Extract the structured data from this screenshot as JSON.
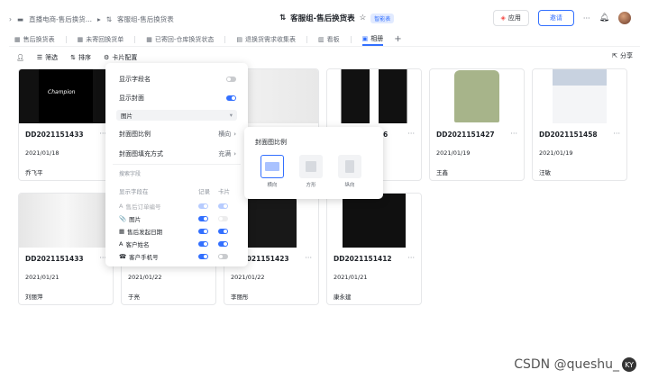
{
  "topbar": {
    "breadcrumb_folder": "直播电商-售后换货...",
    "breadcrumb_sep": "▸",
    "breadcrumb_doc": "客服组-售后换货表",
    "title": "客服组-售后换货表",
    "badge": "智能表",
    "app_label": "应用",
    "share_label": "邀请",
    "more": "···"
  },
  "tabs": [
    {
      "label": "售后换货表"
    },
    {
      "label": "未寄回换货单"
    },
    {
      "label": "已寄回-仓库换货状态"
    },
    {
      "label": "退换货需求收集表"
    },
    {
      "label": "看板"
    },
    {
      "label": "相册",
      "active": true
    }
  ],
  "toolbar": {
    "filter": "筛选",
    "sort": "排序",
    "card_config": "卡片配置",
    "share": "分享"
  },
  "cards": [
    {
      "id": "DD2021151433",
      "date": "2021/01/18",
      "name": "乔飞平",
      "cover": "#111111",
      "more": "···"
    },
    {
      "id": "DD2021151427",
      "date": "2021/01/19",
      "name": "王鑫",
      "cover": "#a7b48a",
      "more": "···"
    },
    {
      "id": "DD2021151458",
      "date": "2021/01/19",
      "name": "汪敏",
      "cover": "#eef0f4",
      "more": "···"
    },
    {
      "id": "DD2021151433",
      "date": "2021/01/21",
      "name": "刘丽萍",
      "cover": "#e8e8e8",
      "more": "···"
    },
    {
      "id": "",
      "date": "2021/01/22",
      "name": "于亮",
      "cover": "#222222",
      "more": "···"
    },
    {
      "id": "DD2021151423",
      "date": "2021/01/22",
      "name": "李丽彤",
      "cover": "#181818",
      "more": "···"
    },
    {
      "id": "DD2021151412",
      "date": "2021/01/21",
      "name": "康永建",
      "cover": "#101010",
      "more": "···"
    }
  ],
  "partial_card": {
    "id_suffix": "6",
    "more": "···"
  },
  "panel": {
    "show_field_name": "显示字段名",
    "show_cover": "显示封面",
    "cover_field": "图片",
    "cover_ratio": "封面图比例",
    "cover_ratio_value": "横向",
    "cover_fill": "封面图填充方式",
    "cover_fill_value": "充满",
    "search_fields": "搜索字段",
    "shown_fields": "显示字段在",
    "col_record": "记录",
    "col_card": "卡片",
    "fields": [
      {
        "label": "售后订单编号",
        "icon": "A",
        "disabled": true
      },
      {
        "label": "图片",
        "icon": "📎",
        "disabled": false
      },
      {
        "label": "售后发起日期",
        "icon": "▦",
        "disabled": false
      },
      {
        "label": "客户姓名",
        "icon": "A",
        "disabled": false
      },
      {
        "label": "客户手机号",
        "icon": "☎",
        "disabled": false
      }
    ]
  },
  "popover": {
    "title": "封面图比例",
    "options": [
      {
        "label": "横向",
        "selected": true
      },
      {
        "label": "方形",
        "selected": false
      },
      {
        "label": "纵向",
        "selected": false
      }
    ]
  },
  "watermark": {
    "text": "CSDN @queshu_",
    "logo": "KY"
  },
  "colors": {
    "accent": "#3370ff"
  }
}
